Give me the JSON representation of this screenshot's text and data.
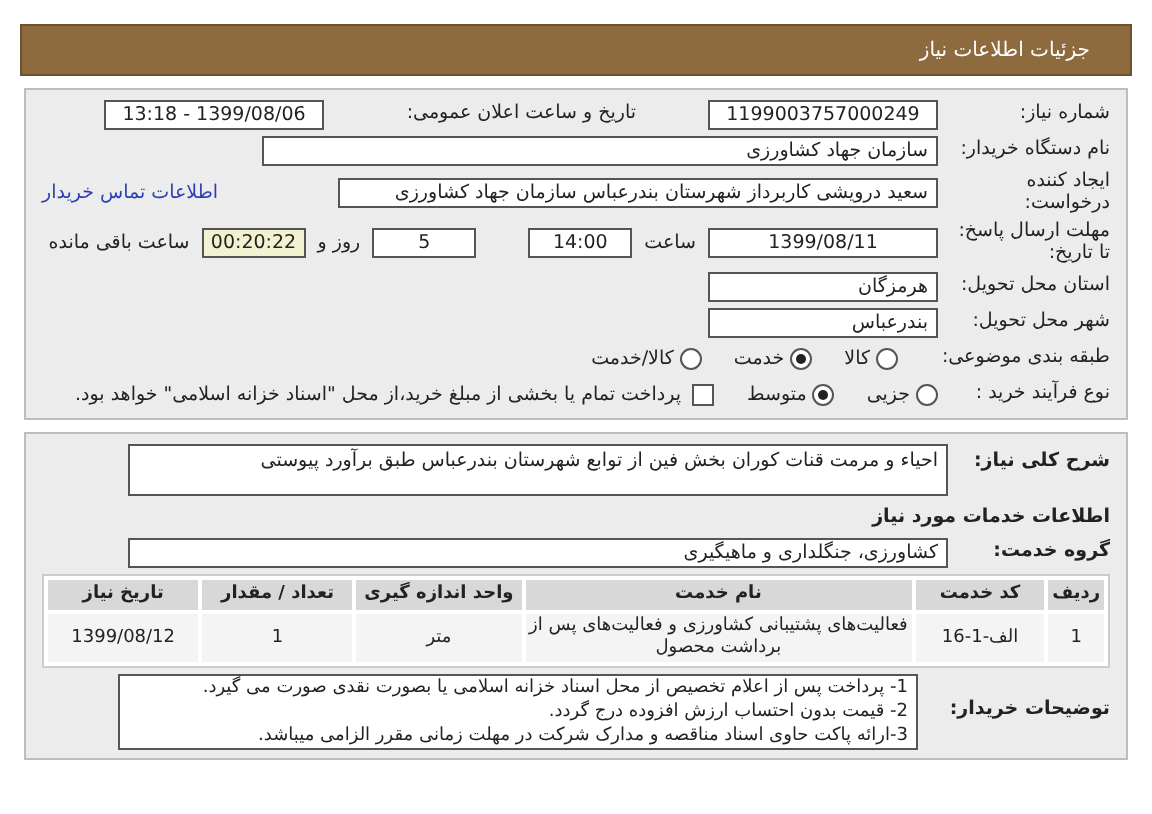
{
  "header": {
    "title": "جزئیات اطلاعات نیاز"
  },
  "need_number": {
    "label": "شماره نیاز:",
    "value": "1199003757000249"
  },
  "announce": {
    "label": "تاریخ و ساعت اعلان عمومی:",
    "value": "1399/08/06 - 13:18"
  },
  "buyer_org": {
    "label": "نام دستگاه خریدار:",
    "value": "سازمان جهاد کشاورزی"
  },
  "requester": {
    "label": "ایجاد کننده درخواست:",
    "value": "سعید درویشی کاربرداز شهرستان بندرعباس سازمان جهاد کشاورزی",
    "link": "اطلاعات تماس خریدار"
  },
  "deadline": {
    "label": "مهلت ارسال پاسخ: تا تاریخ:",
    "date": "1399/08/11",
    "time_label": "ساعت",
    "time": "14:00",
    "days": "5",
    "days_label": "روز و",
    "remaining": "00:20:22",
    "remaining_label": "ساعت باقی مانده"
  },
  "province": {
    "label": "استان محل تحویل:",
    "value": "هرمزگان"
  },
  "city": {
    "label": "شهر محل تحویل:",
    "value": "بندرعباس"
  },
  "category": {
    "label": "طبقه بندی موضوعی:",
    "options": [
      {
        "label": "کالا",
        "selected": false
      },
      {
        "label": "خدمت",
        "selected": true
      },
      {
        "label": "کالا/خدمت",
        "selected": false
      }
    ]
  },
  "process": {
    "label": "نوع فرآیند خرید :",
    "options": [
      {
        "label": "جزیی",
        "selected": false
      },
      {
        "label": "متوسط",
        "selected": true
      }
    ],
    "treasury": {
      "checked": false,
      "text": "پرداخت تمام یا بخشی از مبلغ خرید،از محل \"اسناد خزانه اسلامی\" خواهد بود."
    }
  },
  "description": {
    "label": "شرح کلی نیاز:",
    "value": "احیاء و مرمت قنات کوران بخش فین از توابع شهرستان بندرعباس طبق برآورد پیوستی"
  },
  "services_title": "اطلاعات خدمات مورد نیاز",
  "service_group": {
    "label": "گروه خدمت:",
    "value": "کشاورزی، جنگلداری و ماهیگیری"
  },
  "table": {
    "columns": [
      "ردیف",
      "کد خدمت",
      "نام خدمت",
      "واحد اندازه گیری",
      "تعداد / مقدار",
      "تاریخ نیاز"
    ],
    "rows": [
      [
        "1",
        "الف-1-16",
        "فعالیت‌های پشتیبانی کشاورزی و فعالیت‌های پس از برداشت محصول",
        "متر",
        "1",
        "1399/08/12"
      ]
    ]
  },
  "buyer_notes": {
    "label": "توضیحات خریدار:",
    "lines": [
      "1- پرداخت پس از اعلام تخصیص از محل اسناد خزانه اسلامی یا بصورت نقدی صورت می گیرد.",
      "2- قیمت بدون احتساب ارزش افزوده درج گردد.",
      "3-ارائه پاکت حاوی اسناد مناقصه و مدارک شرکت در مهلت زمانی مقرر الزامی میباشد."
    ]
  }
}
